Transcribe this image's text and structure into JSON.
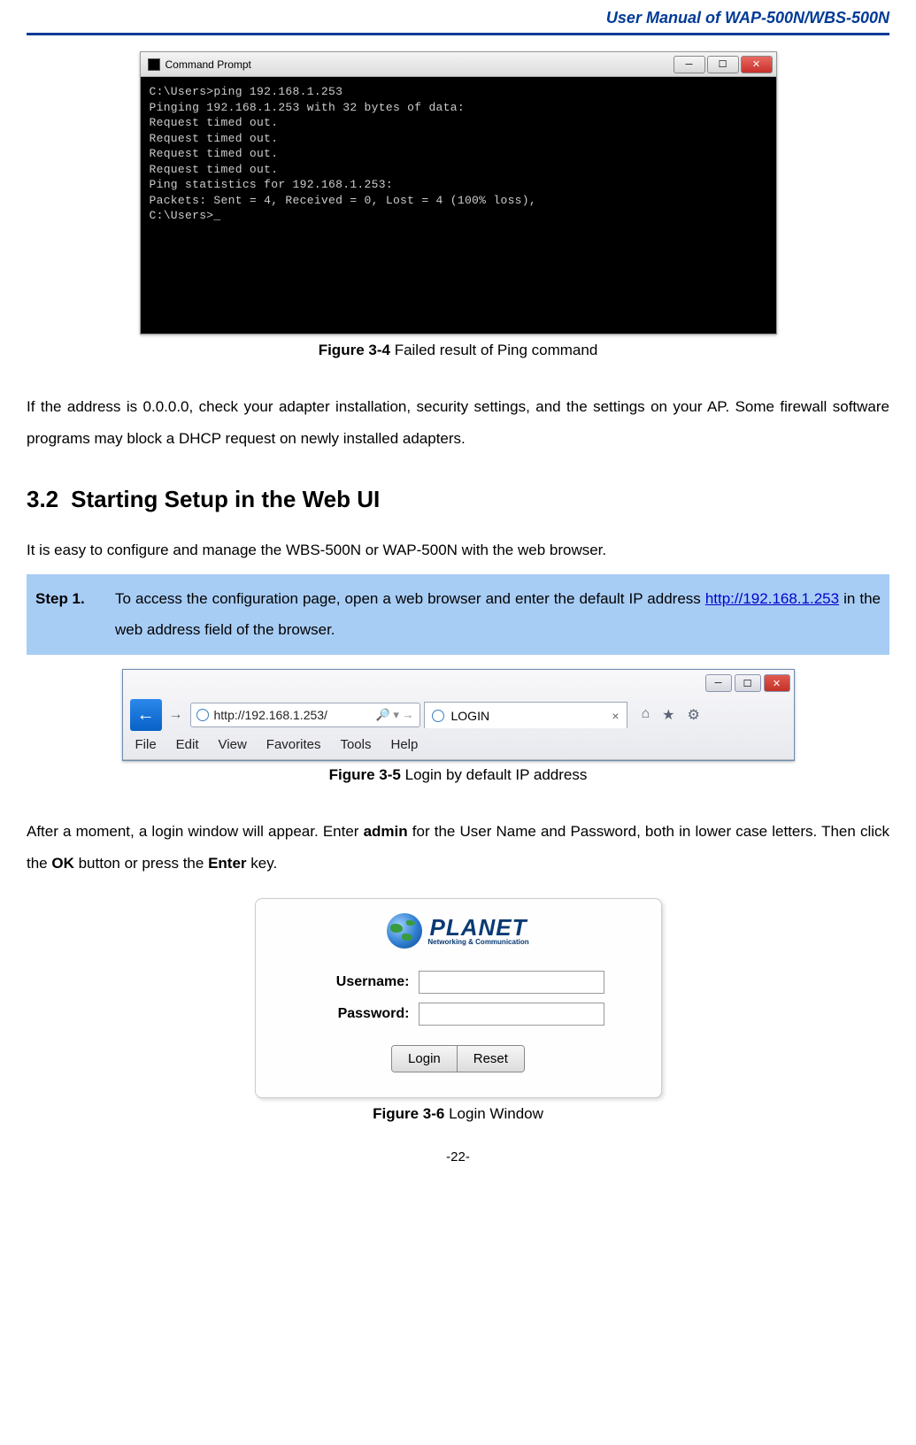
{
  "header": {
    "title": "User Manual of WAP-500N/WBS-500N"
  },
  "cmd": {
    "title": "Command Prompt",
    "lines": [
      "C:\\Users>ping 192.168.1.253",
      "",
      "Pinging 192.168.1.253 with 32 bytes of data:",
      "Request timed out.",
      "Request timed out.",
      "Request timed out.",
      "Request timed out.",
      "",
      "Ping statistics for 192.168.1.253:",
      "    Packets: Sent = 4, Received = 0, Lost = 4 (100% loss),",
      "",
      "C:\\Users>_"
    ]
  },
  "figure34": {
    "label": "Figure 3-4",
    "text": "Failed result of Ping command"
  },
  "para1": "If the address is 0.0.0.0, check your adapter installation, security settings, and the settings on your AP. Some firewall software programs may block a DHCP request on newly installed adapters.",
  "section": {
    "num": "3.2",
    "title": "Starting Setup in the Web UI"
  },
  "intro": "It is easy to configure and manage the WBS-500N or WAP-500N with the web browser.",
  "step1": {
    "label": "Step 1.",
    "pre": "To access the configuration page, open a web browser and enter the default IP address ",
    "link": "http://192.168.1.253",
    "post": " in the web address field of the browser."
  },
  "browser": {
    "url": "http://192.168.1.253/",
    "search_hint": "🔎 ▾ →",
    "tab_title": "LOGIN",
    "menu": [
      "File",
      "Edit",
      "View",
      "Favorites",
      "Tools",
      "Help"
    ]
  },
  "figure35": {
    "label": "Figure 3-5",
    "text": "Login by default IP address"
  },
  "after_login": {
    "p1": "After a moment, a login window will appear. Enter ",
    "b1": "admin",
    "p2": " for the User Name and Password, both in lower case letters. Then click the ",
    "b2": "OK",
    "p3": " button or press the ",
    "b3": "Enter",
    "p4": " key."
  },
  "login_form": {
    "brand_big": "PLANET",
    "brand_small": "Networking & Communication",
    "username_label": "Username:",
    "password_label": "Password:",
    "login_btn": "Login",
    "reset_btn": "Reset"
  },
  "figure36": {
    "label": "Figure 3-6",
    "text": "Login Window"
  },
  "page_number": "-22-"
}
